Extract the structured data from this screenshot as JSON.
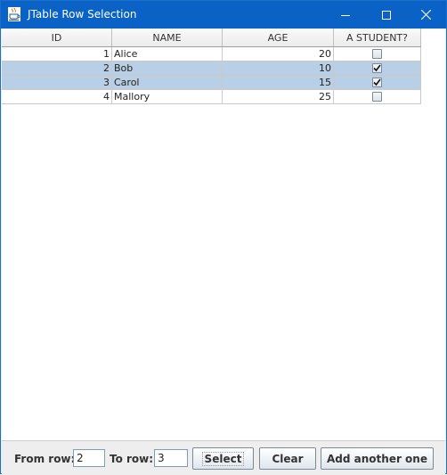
{
  "window": {
    "title": "JTable Row Selection",
    "titlebar_color": "#0a62c7"
  },
  "table": {
    "columns": [
      "ID",
      "NAME",
      "AGE",
      "A STUDENT?"
    ],
    "rows": [
      {
        "id": "1",
        "name": "Alice",
        "age": "20",
        "student": false,
        "selected": false
      },
      {
        "id": "2",
        "name": "Bob",
        "age": "10",
        "student": true,
        "selected": true
      },
      {
        "id": "3",
        "name": "Carol",
        "age": "15",
        "student": true,
        "selected": true
      },
      {
        "id": "4",
        "name": "Mallory",
        "age": "25",
        "student": false,
        "selected": false
      }
    ],
    "selection_color": "#b8cfe5"
  },
  "controls": {
    "from_label": "From row:",
    "from_value": "2",
    "to_label": "To row:",
    "to_value": "3",
    "select_label": "Select",
    "clear_label": "Clear",
    "add_label": "Add another one"
  }
}
